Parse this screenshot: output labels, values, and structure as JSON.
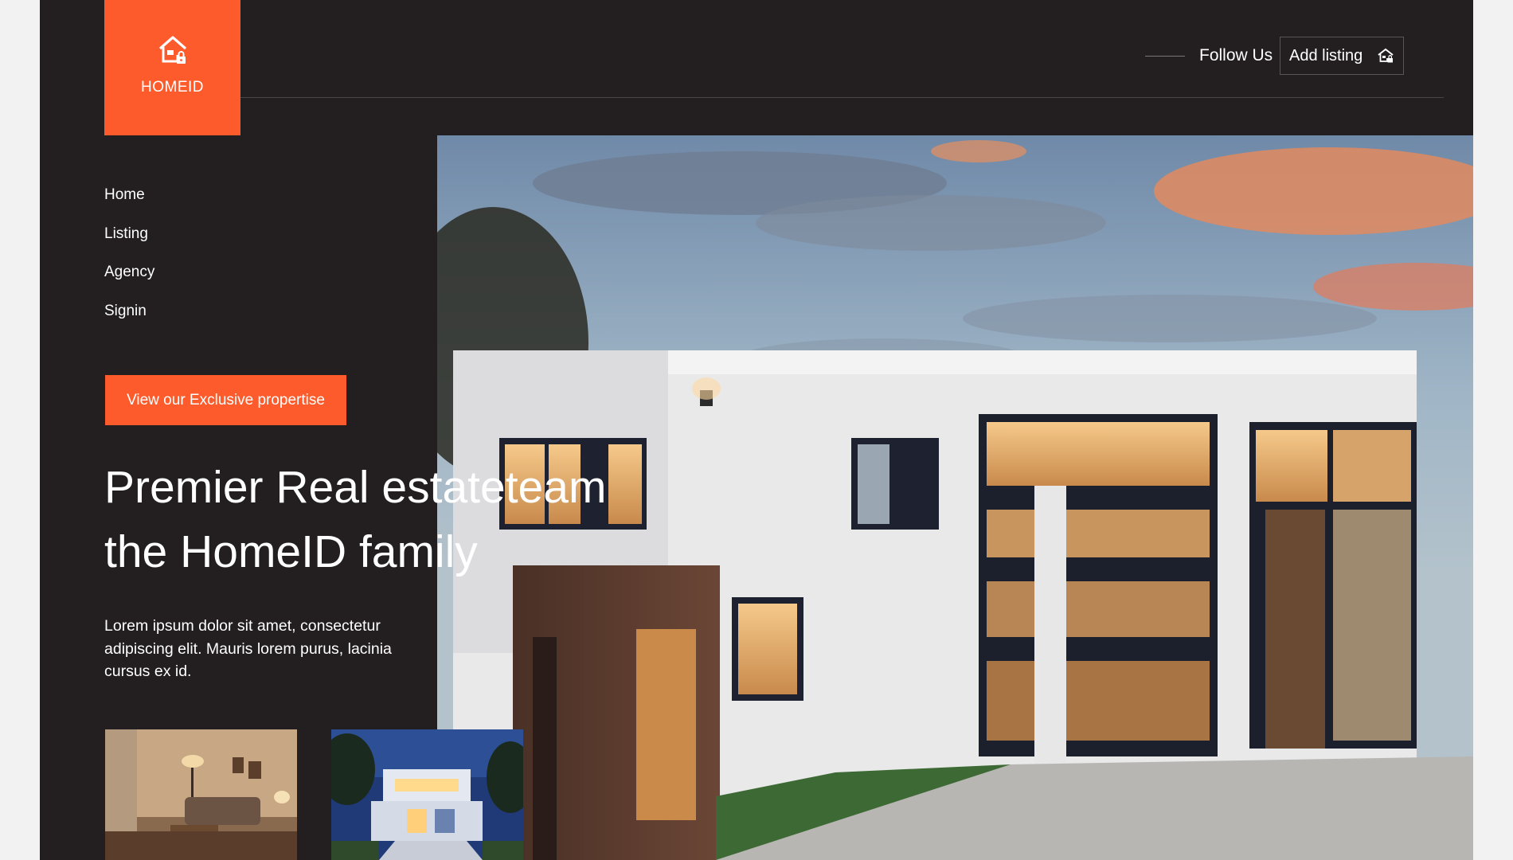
{
  "brand": {
    "name": "HOMEID",
    "icon": "house-icon",
    "accent": "#fe5b2c"
  },
  "header": {
    "follow_label": "Follow Us",
    "add_listing_label": "Add listing",
    "add_listing_icon": "house-icon"
  },
  "nav": {
    "items": [
      {
        "label": "Home"
      },
      {
        "label": "Listing"
      },
      {
        "label": "Agency"
      },
      {
        "label": "Signin"
      }
    ]
  },
  "hero": {
    "cta_label": "View our Exclusive propertise",
    "headline_line1": "Premier Real estateteam",
    "headline_line2": "the HomeID family",
    "body": "Lorem ipsum dolor sit amet, consectetur adipiscing elit. Mauris lorem purus, lacinia cursus ex id."
  },
  "colors": {
    "background": "#231f20",
    "page_gutter": "#f2f2f2",
    "text": "#ffffff"
  }
}
